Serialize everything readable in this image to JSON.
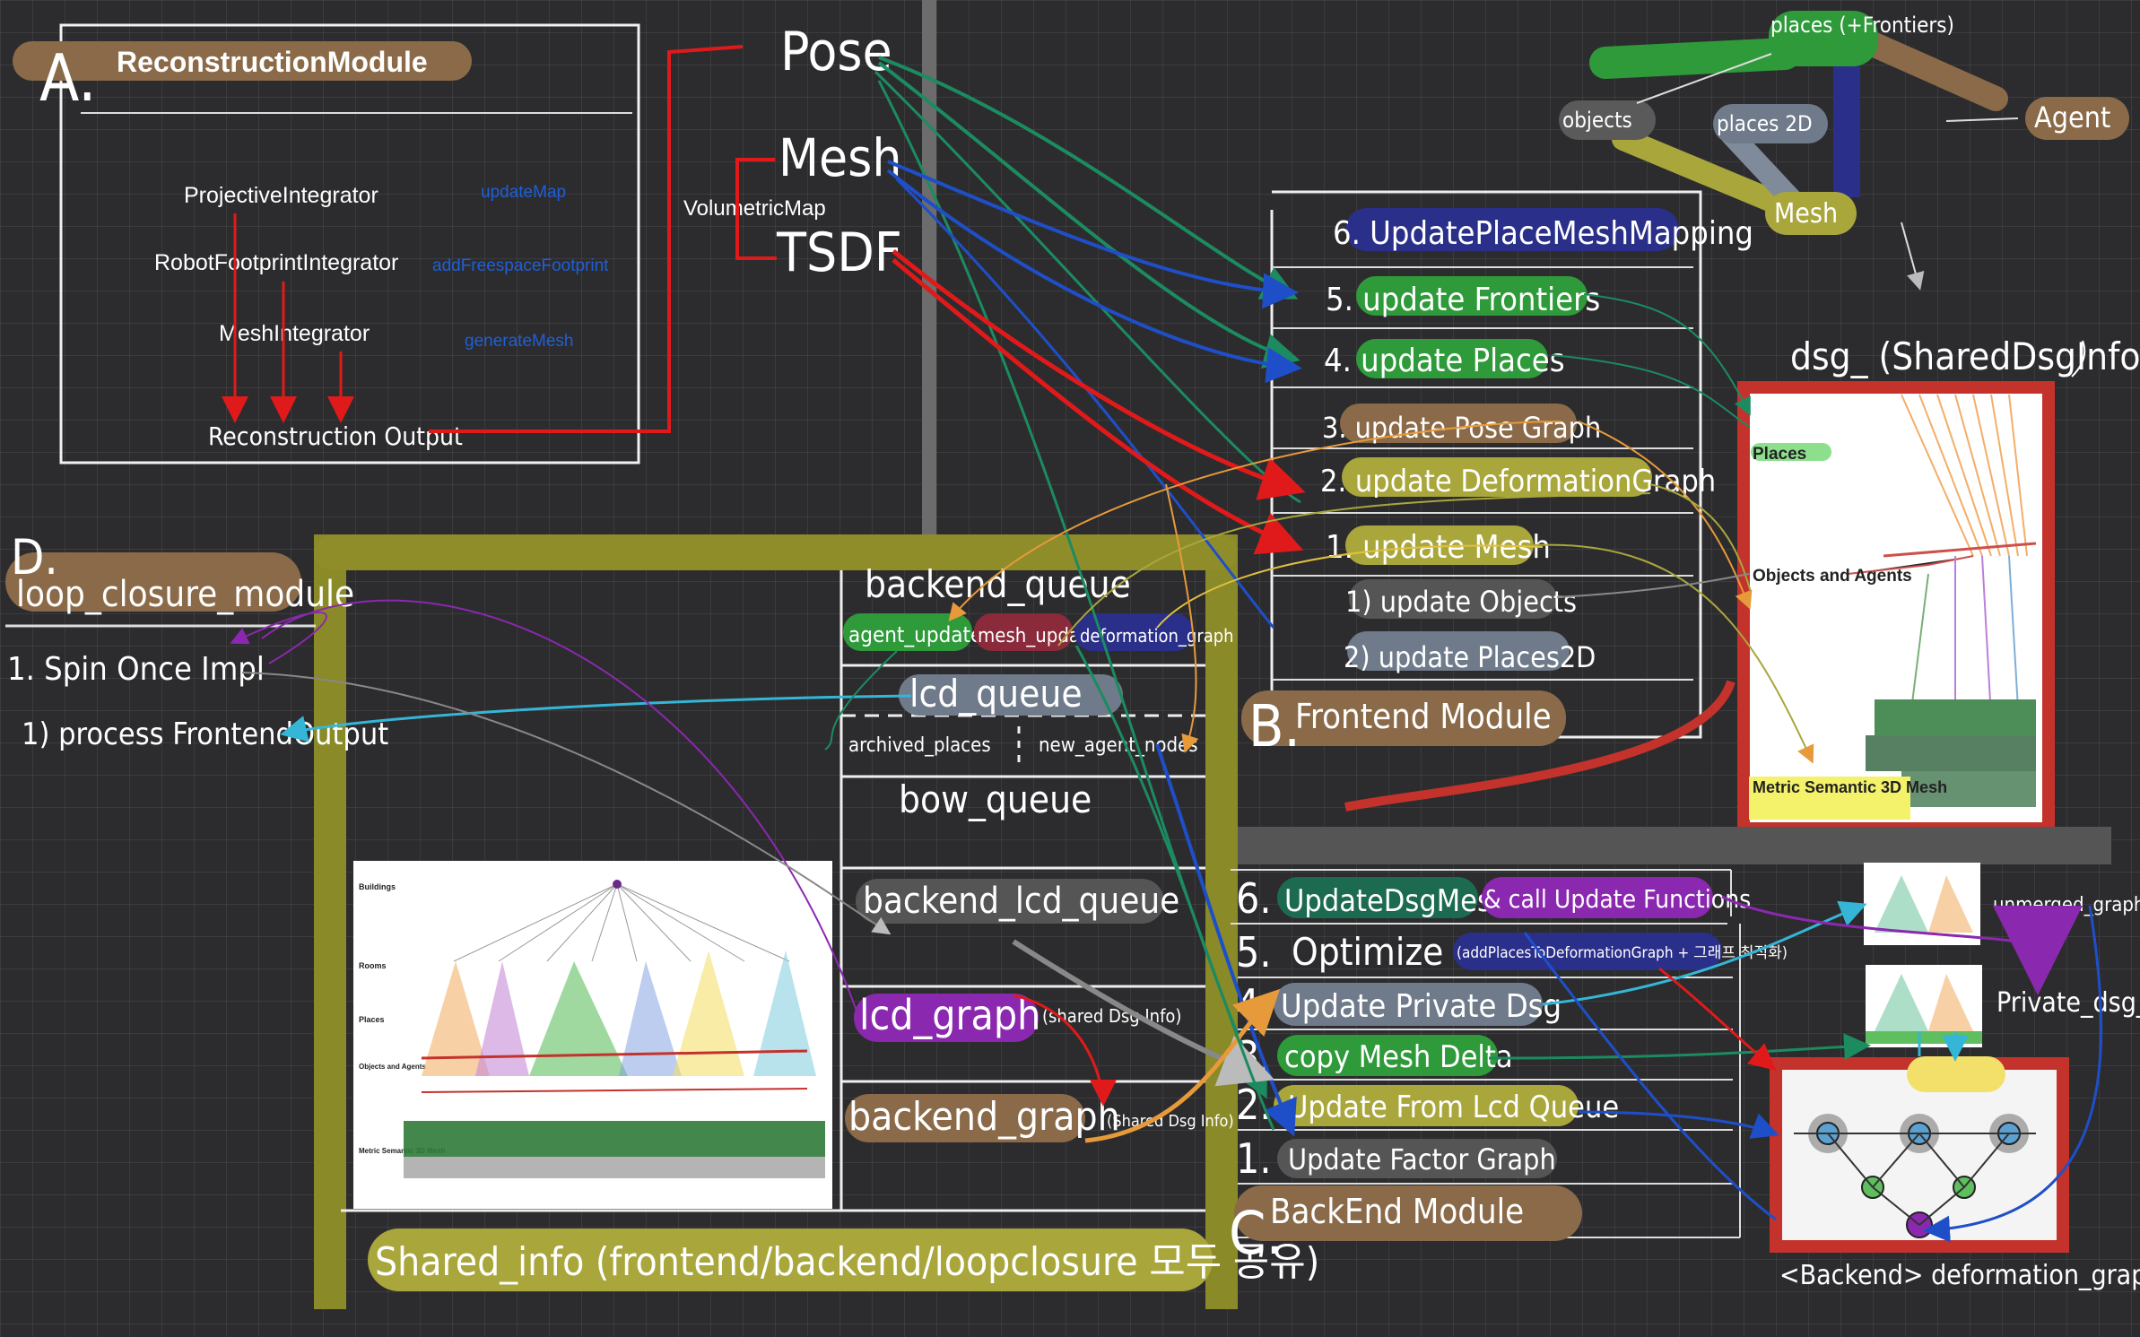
{
  "recon": {
    "letter": "A.",
    "title": "ReconstructionModule",
    "integrators": [
      {
        "name": "ProjectiveIntegrator",
        "method": "updateMap"
      },
      {
        "name": "RobotFootprintIntegrator",
        "method": "addFreespaceFootprint"
      },
      {
        "name": "MeshIntegrator",
        "method": "generateMesh"
      }
    ],
    "output": "Reconstruction Output",
    "volumetric_map": "VolumetricMap",
    "outputs": [
      "Pose",
      "Mesh",
      "TSDF"
    ]
  },
  "frontend": {
    "letter": "B.",
    "title": "Frontend Module",
    "steps": [
      "6. UpdatePlaceMeshMapping",
      "5. update Frontiers",
      "4. update Places",
      "3. update Pose Graph",
      "2. update DeformationGraph",
      "1. update Mesh"
    ],
    "sub_steps": [
      "1) update Objects",
      "2) update Places2D"
    ]
  },
  "dsg": {
    "title": "dsg_ (SharedDsgInfo)",
    "layers": [
      "Places",
      "Objects and Agents",
      "Metric Semantic 3D Mesh"
    ],
    "graph_nodes": [
      "places (+Frontiers)",
      "objects",
      "places 2D",
      "Mesh",
      "Agent"
    ]
  },
  "loop": {
    "letter": "D.",
    "title": "loop_closure_module",
    "steps": [
      "1. Spin Once Impl",
      "1) process FrontendOutput"
    ]
  },
  "shared": {
    "queues": [
      "backend_queue",
      "lcd_queue",
      "bow_queue",
      "backend_lcd_queue"
    ],
    "backend_queue_items": [
      "agent_updates",
      "mesh_update",
      "deformation_graph"
    ],
    "lcd_queue_items": [
      "archived_places",
      "new_agent_nodes"
    ],
    "lcd_graph": "lcd_graph",
    "lcd_graph_note": "(shared Dsg Info)",
    "backend_graph": "backend_graph",
    "backend_graph_note": "(Shared Dsg Info)",
    "label": "Shared_info (frontend/backend/loopclosure 모두 공유)",
    "thumb_layers": [
      "Buildings",
      "Rooms",
      "Places",
      "Objects and Agents",
      "Metric Semantic 3D Mesh"
    ]
  },
  "backend": {
    "letter": "C.",
    "title": "BackEnd Module",
    "steps": [
      {
        "num": "6.",
        "text": "UpdateDsgMesh",
        "extra": "& call Update Functions"
      },
      {
        "num": "5.",
        "text": "Optimize",
        "extra": "(addPlacesToDeformationGraph + 그래프 최적화)"
      },
      {
        "num": "4.",
        "text": "Update Private Dsg",
        "extra": ""
      },
      {
        "num": "3.",
        "text": "copy Mesh Delta",
        "extra": ""
      },
      {
        "num": "2.",
        "text": "Update From Lcd Queue",
        "extra": ""
      },
      {
        "num": "1.",
        "text": "Update Factor Graph",
        "extra": ""
      }
    ],
    "unmerged": "unmerged_graph",
    "private": "Private_dsg_",
    "deformation_caption": "<Backend> deformation_graph"
  },
  "colors": {
    "red": "#e01a1a",
    "green": "#2e9a3a",
    "darkgreen": "#1c6b50",
    "blue": "#1f4fc8",
    "cyan": "#35b6d6",
    "orange": "#e79a3a",
    "purple": "#8b28b0",
    "olive": "#a9a63c",
    "brownhl": "#8a6a48"
  }
}
